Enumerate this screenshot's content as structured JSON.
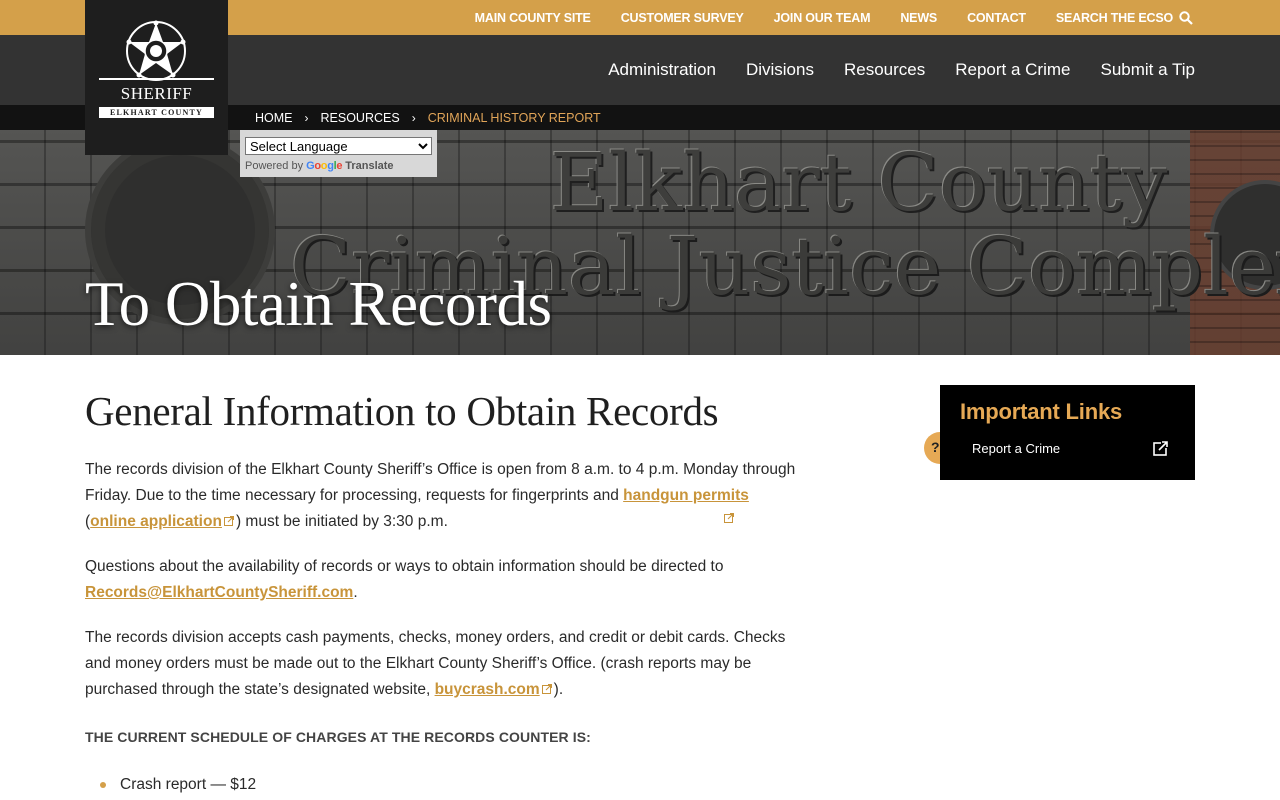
{
  "utility_nav": {
    "items": [
      "MAIN COUNTY SITE",
      "CUSTOMER SURVEY",
      "JOIN OUR TEAM",
      "NEWS",
      "CONTACT"
    ],
    "search_label": "SEARCH THE ECSO"
  },
  "logo": {
    "title": "SHERIFF",
    "subtitle": "ELKHART COUNTY"
  },
  "main_nav": {
    "items": [
      "Administration",
      "Divisions",
      "Resources",
      "Report a Crime",
      "Submit a Tip"
    ]
  },
  "breadcrumb": {
    "home": "HOME",
    "resources": "RESOURCES",
    "current": "CRIMINAL HISTORY REPORT"
  },
  "translate": {
    "select_value": "Select Language",
    "powered_by": "Powered by",
    "google": "Google",
    "translate": "Translate"
  },
  "hero": {
    "title": "To Obtain Records",
    "engraving_line1": "Elkhart County",
    "engraving_line2": "Criminal Justice Complex"
  },
  "content": {
    "heading": "General Information to Obtain Records",
    "p1_text1": "The records division of the Elkhart County Sheriff’s Office is open from 8 a.m. to 4 p.m. Monday through Friday. Due to the time necessary for processing, requests for fingerprints and ",
    "p1_link1": "handgun permits",
    "p1_text2": " (",
    "p1_link2": "online application",
    "p1_text3": ") must be initiated by 3:30 p.m.",
    "p2_text1": "Questions about the availability of records or ways to obtain information should be directed to ",
    "p2_link": "Records@ElkhartCountySheriff.com",
    "p2_text2": ".",
    "p3_text1": "The records division accepts cash payments, checks, money orders, and credit or debit cards. Checks and money orders must be made out to the Elkhart County Sheriff’s Office. (crash reports may be purchased through the state’s designated website, ",
    "p3_link": "buycrash.com",
    "p3_text2": ").",
    "schedule_heading": "THE CURRENT SCHEDULE OF CHARGES AT THE RECORDS COUNTER IS:",
    "charges": [
      "Crash report — $12"
    ]
  },
  "sidebar": {
    "title": "Important Links",
    "links": [
      "Report a Crime"
    ]
  },
  "help_tab": {
    "label": "?"
  },
  "colors": {
    "gold": "#d4a04a",
    "link_gold": "#c8943a",
    "nav_dark": "#333333",
    "sidebar_title": "#e6a955"
  }
}
